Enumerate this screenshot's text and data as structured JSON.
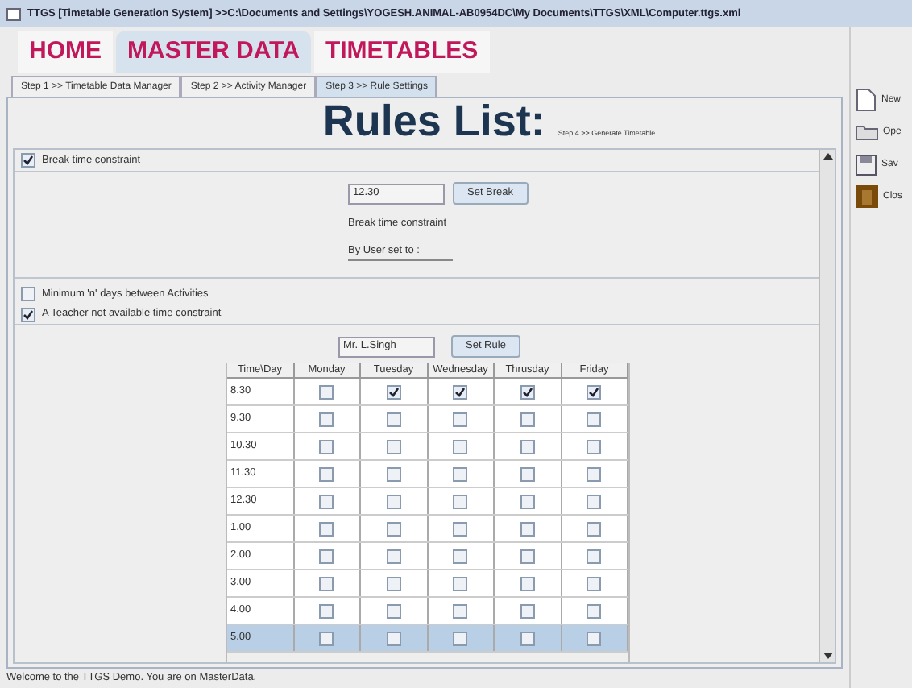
{
  "window": {
    "title": "TTGS [Timetable Generation System] >>C:\\Documents and Settings\\YOGESH.ANIMAL-AB0954DC\\My Documents\\TTGS\\XML\\Computer.ttgs.xml"
  },
  "menu_tabs": [
    {
      "label": "HOME",
      "selected": false
    },
    {
      "label": "MASTER DATA",
      "selected": true
    },
    {
      "label": "TIMETABLES",
      "selected": false
    }
  ],
  "step_tabs": [
    {
      "label": "Step 1 >> Timetable Data Manager",
      "selected": false
    },
    {
      "label": "Step 2 >> Activity Manager",
      "selected": false
    },
    {
      "label": "Step 3 >> Rule Settings",
      "selected": true
    }
  ],
  "heading": "Rules List:",
  "next_step_link": "Step 4 >> Generate Timetable",
  "break_rule": {
    "label": "Break time constraint",
    "checked": true,
    "time_value": "12.30",
    "button": "Set Break",
    "caption": "Break time constraint",
    "user_set_label": "By User set to :"
  },
  "min_days_rule": {
    "label": "Minimum 'n' days between Activities",
    "checked": false
  },
  "teacher_rule": {
    "label": "A Teacher not available time constraint",
    "checked": true,
    "teacher_value": "Mr. L.Singh",
    "button": "Set Rule"
  },
  "table": {
    "columns": [
      "Time\\Day",
      "Monday",
      "Tuesday",
      "Wednesday",
      "Thrusday",
      "Friday"
    ],
    "rows": [
      {
        "time": "8.30",
        "selected": false,
        "days": [
          false,
          true,
          true,
          true,
          true
        ]
      },
      {
        "time": "9.30",
        "selected": false,
        "days": [
          false,
          false,
          false,
          false,
          false
        ]
      },
      {
        "time": "10.30",
        "selected": false,
        "days": [
          false,
          false,
          false,
          false,
          false
        ]
      },
      {
        "time": "11.30",
        "selected": false,
        "days": [
          false,
          false,
          false,
          false,
          false
        ]
      },
      {
        "time": "12.30",
        "selected": false,
        "days": [
          false,
          false,
          false,
          false,
          false
        ]
      },
      {
        "time": "1.00",
        "selected": false,
        "days": [
          false,
          false,
          false,
          false,
          false
        ]
      },
      {
        "time": "2.00",
        "selected": false,
        "days": [
          false,
          false,
          false,
          false,
          false
        ]
      },
      {
        "time": "3.00",
        "selected": false,
        "days": [
          false,
          false,
          false,
          false,
          false
        ]
      },
      {
        "time": "4.00",
        "selected": false,
        "days": [
          false,
          false,
          false,
          false,
          false
        ]
      },
      {
        "time": "5.00",
        "selected": true,
        "days": [
          false,
          false,
          false,
          false,
          false
        ]
      }
    ]
  },
  "side_actions": [
    {
      "label": "New",
      "kind": "new"
    },
    {
      "label": "Ope",
      "kind": "open"
    },
    {
      "label": "Sav",
      "kind": "save"
    },
    {
      "label": "Clos",
      "kind": "close"
    }
  ],
  "status_bar": "Welcome to the TTGS Demo. You are on MasterData."
}
